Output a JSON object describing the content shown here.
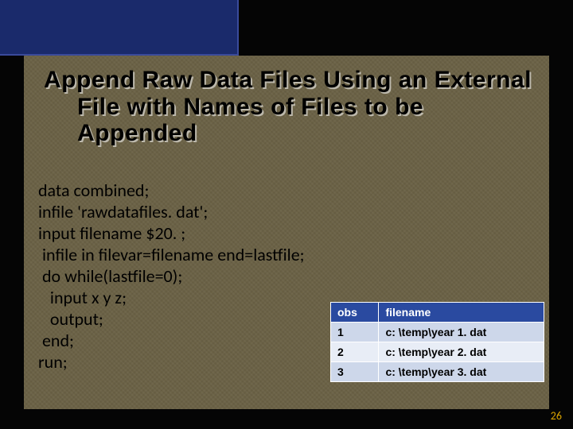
{
  "title": {
    "line1": "Append Raw Data Files Using an External",
    "line2": "File with Names of Files to be",
    "line3": "Appended"
  },
  "code": {
    "l1": "data combined;",
    "l2": "infile 'rawdatafiles. dat';",
    "l3": "input filename $20. ;",
    "l4": " infile in filevar=filename end=lastfile;",
    "l5": " do while(lastfile=0);",
    "l6": "   input x y z;",
    "l7": "   output;",
    "l8": " end;",
    "l9": "run;"
  },
  "table": {
    "headers": {
      "c1": "obs",
      "c2": "filename"
    },
    "rows": [
      {
        "c1": "1",
        "c2": "c: \\temp\\year 1. dat"
      },
      {
        "c1": "2",
        "c2": "c: \\temp\\year 2. dat"
      },
      {
        "c1": "3",
        "c2": "c: \\temp\\year 3. dat"
      }
    ]
  },
  "page_number": "26"
}
